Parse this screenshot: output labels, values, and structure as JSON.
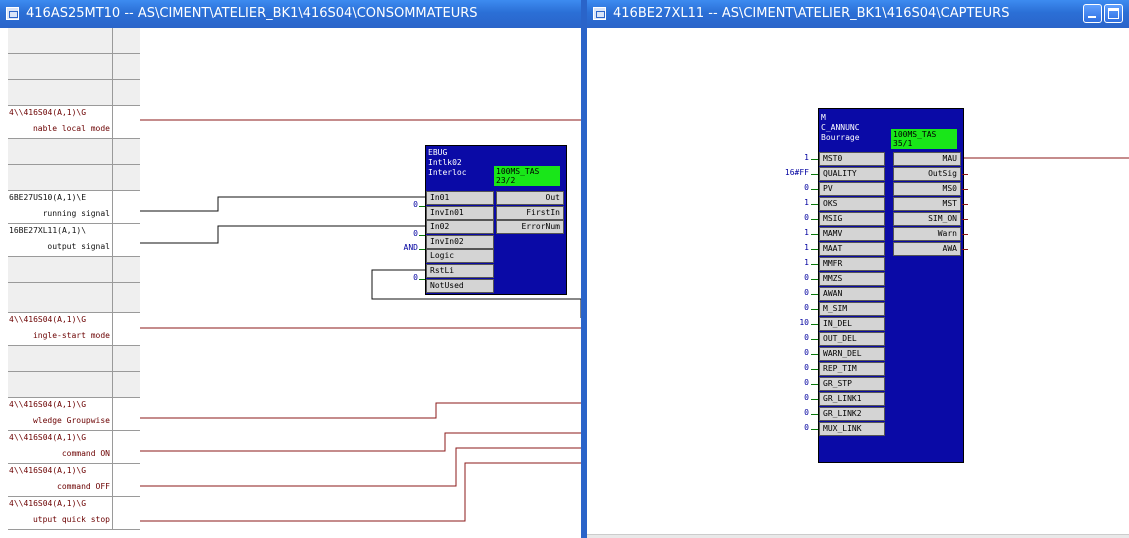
{
  "left_window": {
    "title": "416AS25MT10 -- AS\\CIMENT\\ATELIER_BK1\\416S04\\CONSOMMATEURS",
    "rows": [
      {
        "l1": "",
        "l2": ""
      },
      {
        "l1": "",
        "l2": ""
      },
      {
        "l1": "",
        "l2": ""
      },
      {
        "l1": "4\\\\416S04(A,1)\\G",
        "l2": "nable local mode"
      },
      {
        "l1": "",
        "l2": ""
      },
      {
        "l1": "",
        "l2": ""
      },
      {
        "l1": "6BE27US10(A,1)\\E",
        "l2": "running signal"
      },
      {
        "l1": "16BE27XL11(A,1)\\",
        "l2": "output signal"
      },
      {
        "l1": "",
        "l2": ""
      },
      {
        "l1": "",
        "l2": ""
      },
      {
        "l1": "4\\\\416S04(A,1)\\G",
        "l2": "ingle-start mode"
      },
      {
        "l1": "",
        "l2": ""
      },
      {
        "l1": "",
        "l2": ""
      },
      {
        "l1": "4\\\\416S04(A,1)\\G",
        "l2": "wledge Groupwise"
      },
      {
        "l1": "4\\\\416S04(A,1)\\G",
        "l2": "command ON"
      },
      {
        "l1": "4\\\\416S04(A,1)\\G",
        "l2": "command OFF"
      },
      {
        "l1": "4\\\\416S04(A,1)\\G",
        "l2": "utput quick stop"
      }
    ],
    "block": {
      "header": "EBUG\nIntlk02\nInterloc",
      "task": "100MS_TAS\n23/2",
      "inputs": [
        "In01",
        "InvIn01",
        "In02",
        "InvIn02",
        "Logic",
        "RstLi",
        "NotUsed"
      ],
      "input_values": [
        "",
        "0",
        "",
        "0",
        "AND",
        "",
        "0"
      ],
      "outputs": [
        "Out",
        "FirstIn",
        "ErrorNum"
      ]
    }
  },
  "right_window": {
    "title": "416BE27XL11 -- AS\\CIMENT\\ATELIER_BK1\\416S04\\CAPTEURS",
    "block": {
      "header": "M\nC_ANNUNC\nBourrage",
      "task": "100MS_TAS\n35/1",
      "inputs": [
        "MST0",
        "QUALITY",
        "PV",
        "OKS",
        "MSIG",
        "MAMV",
        "MAAT",
        "MMFR",
        "MMZS",
        "AWAN",
        "M_SIM",
        "IN_DEL",
        "OUT_DEL",
        "WARN_DEL",
        "REP_TIM",
        "GR_STP",
        "GR_LINK1",
        "GR_LINK2",
        "MUX_LINK"
      ],
      "input_values": [
        "1",
        "16#FF",
        "0",
        "1",
        "0",
        "1",
        "1",
        "1",
        "0",
        "0",
        "0",
        "10",
        "0",
        "0",
        "0",
        "0",
        "0",
        "0",
        "0"
      ],
      "outputs": [
        "MAU",
        "OutSig",
        "MS0",
        "MST",
        "SIM_ON",
        "Warn",
        "AWA"
      ]
    }
  },
  "colors": {
    "titlebar": "#2b6fd6",
    "block": "#0a0aa6",
    "task": "#19e619",
    "wire_red": "#8b1a1a",
    "wire_dark": "#111111"
  },
  "icons": [
    "window-icon",
    "minimize-icon",
    "maximize-icon"
  ]
}
